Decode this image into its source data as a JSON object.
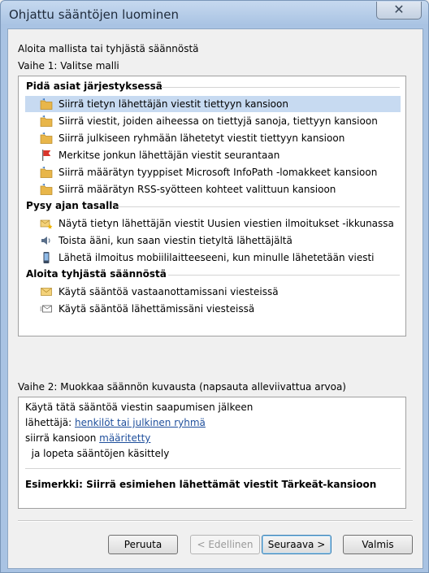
{
  "window": {
    "title": "Ohjattu sääntöjen luominen",
    "close_glyph": "✕"
  },
  "intro": {
    "heading": "Aloita mallista tai tyhjästä säännöstä",
    "step1_label": "Vaihe 1: Valitse malli"
  },
  "groups": [
    {
      "heading": "Pidä asiat järjestyksessä",
      "items": [
        {
          "label": "Siirrä tietyn lähettäjän viestit tiettyyn kansioon",
          "icon": "folder-move-icon",
          "selected": true
        },
        {
          "label": "Siirrä viestit, joiden aiheessa on tiettyjä sanoja, tiettyyn kansioon",
          "icon": "folder-move-icon",
          "selected": false
        },
        {
          "label": "Siirrä julkiseen ryhmään lähetetyt viestit tiettyyn kansioon",
          "icon": "folder-move-icon",
          "selected": false
        },
        {
          "label": "Merkitse jonkun lähettäjän viestit seurantaan",
          "icon": "red-flag-icon",
          "selected": false
        },
        {
          "label": "Siirrä määrätyn tyyppiset Microsoft InfoPath -lomakkeet kansioon",
          "icon": "folder-move-icon",
          "selected": false
        },
        {
          "label": "Siirrä määrätyn RSS-syötteen kohteet valittuun kansioon",
          "icon": "folder-move-icon",
          "selected": false
        }
      ]
    },
    {
      "heading": "Pysy ajan tasalla",
      "items": [
        {
          "label": "Näytä tietyn lähettäjän viestit Uusien viestien ilmoitukset -ikkunassa",
          "icon": "mail-star-icon",
          "selected": false
        },
        {
          "label": "Toista ääni, kun saan viestin tietyltä lähettäjältä",
          "icon": "speaker-icon",
          "selected": false
        },
        {
          "label": "Lähetä ilmoitus mobiililaitteeseeni, kun minulle lähetetään viesti",
          "icon": "mobile-phone-icon",
          "selected": false
        }
      ]
    },
    {
      "heading": "Aloita tyhjästä säännöstä",
      "items": [
        {
          "label": "Käytä sääntöä vastaanottamissani viesteissä",
          "icon": "envelope-icon",
          "selected": false
        },
        {
          "label": "Käytä sääntöä lähettämissäni viesteissä",
          "icon": "send-envelope-icon",
          "selected": false
        }
      ]
    }
  ],
  "step2": {
    "label": "Vaihe 2: Muokkaa säännön kuvausta (napsauta alleviivattua arvoa)",
    "line1": "Käytä tätä sääntöä viestin saapumisen jälkeen",
    "line2_prefix": "lähettäjä: ",
    "line2_link": "henkilöt tai julkinen ryhmä",
    "line3_prefix": "siirrä kansioon ",
    "line3_link": "määritetty",
    "line4": "  ja lopeta sääntöjen käsittely",
    "example": "Esimerkki: Siirrä esimiehen lähettämät viestit Tärkeät-kansioon"
  },
  "buttons": {
    "cancel": "Peruuta",
    "back": "< Edellinen",
    "next": "Seuraava >",
    "finish": "Valmis"
  },
  "colors": {
    "selection": "#c7daf1",
    "link": "#1f4f9c",
    "folder": "#e8b64a",
    "flag": "#d9352b"
  }
}
